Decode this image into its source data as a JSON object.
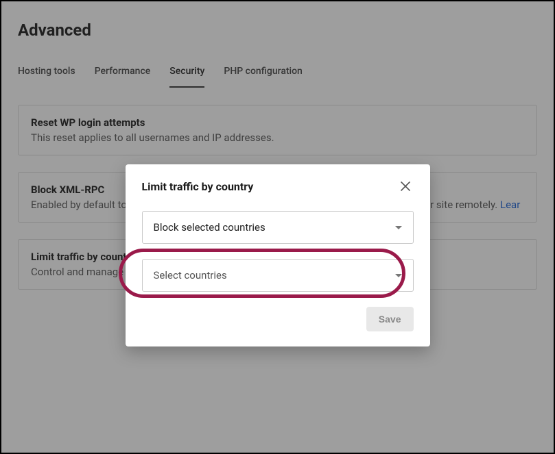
{
  "page_title": "Advanced",
  "tabs": [
    {
      "label": "Hosting tools",
      "active": false
    },
    {
      "label": "Performance",
      "active": false
    },
    {
      "label": "Security",
      "active": true
    },
    {
      "label": "PHP configuration",
      "active": false
    }
  ],
  "cards": [
    {
      "title": "Reset WP login attempts",
      "desc": "This reset applies to all usernames and IP addresses."
    },
    {
      "title": "Block XML-RPC",
      "desc_prefix": "Enabled by default to protect your login URL from brute attacks and from publishing your site remotely. ",
      "link_text": "Lear"
    },
    {
      "title": "Limit traffic by country",
      "desc": "Control and manage your traffic by blocking or allowing it by country."
    }
  ],
  "modal": {
    "title": "Limit traffic by country",
    "mode_select": {
      "value": "Block selected countries"
    },
    "country_select": {
      "placeholder": "Select countries"
    },
    "save_label": "Save"
  }
}
